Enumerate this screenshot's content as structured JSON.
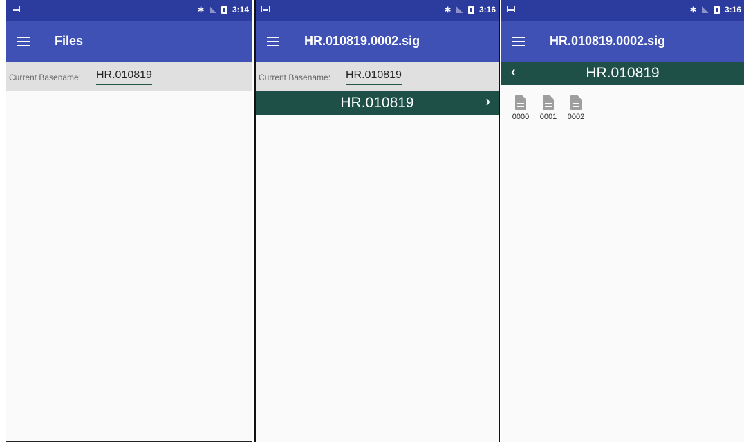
{
  "screens": [
    {
      "status": {
        "time": "3:14"
      },
      "appbar": {
        "title": "Files"
      },
      "basename": {
        "label": "Current Basename:",
        "value": "HR.010819"
      }
    },
    {
      "status": {
        "time": "3:16"
      },
      "appbar": {
        "title": "HR.010819.0002.sig"
      },
      "basename": {
        "label": "Current Basename:",
        "value": "HR.010819"
      },
      "folder": {
        "name": "HR.010819",
        "chevron": "›"
      }
    },
    {
      "status": {
        "time": "3:16"
      },
      "appbar": {
        "title": "HR.010819.0002.sig"
      },
      "folder": {
        "name": "HR.010819",
        "chevron": "‹"
      },
      "files": [
        "0000",
        "0001",
        "0002"
      ]
    }
  ],
  "colors": {
    "status_bar": "#2c3c9e",
    "app_bar": "#3f51b5",
    "folder_bar": "#1e5047",
    "basename_bar": "#e0e0e0",
    "file_icon": "#9e9e9e"
  },
  "icons": [
    "image-notification-icon",
    "bluetooth-icon",
    "no-signal-icon",
    "battery-icon",
    "menu-icon",
    "chevron-right-icon",
    "chevron-left-icon",
    "file-icon"
  ]
}
